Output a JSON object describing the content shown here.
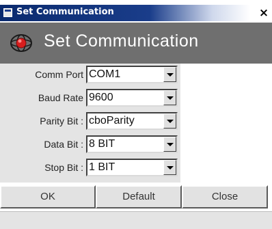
{
  "window": {
    "title": "Set Communication",
    "close_glyph": "×",
    "title_icon": "window-icon",
    "colors": {
      "titlebar": "#0a2a6e",
      "header": "#6f6f6f",
      "form_bg": "#e4e4e4"
    }
  },
  "header": {
    "title": "Set Communication",
    "logo_icon": "red-globe-icon"
  },
  "form": {
    "fields": [
      {
        "label": "Comm Port",
        "value": "COM1"
      },
      {
        "label": "Baud Rate",
        "value": "9600"
      },
      {
        "label": "Parity Bit :",
        "value": "cboParity"
      },
      {
        "label": "Data Bit :",
        "value": "8 BIT"
      },
      {
        "label": "Stop Bit :",
        "value": "1 BIT"
      }
    ]
  },
  "buttons": {
    "ok": "OK",
    "default": "Default",
    "close": "Close"
  }
}
